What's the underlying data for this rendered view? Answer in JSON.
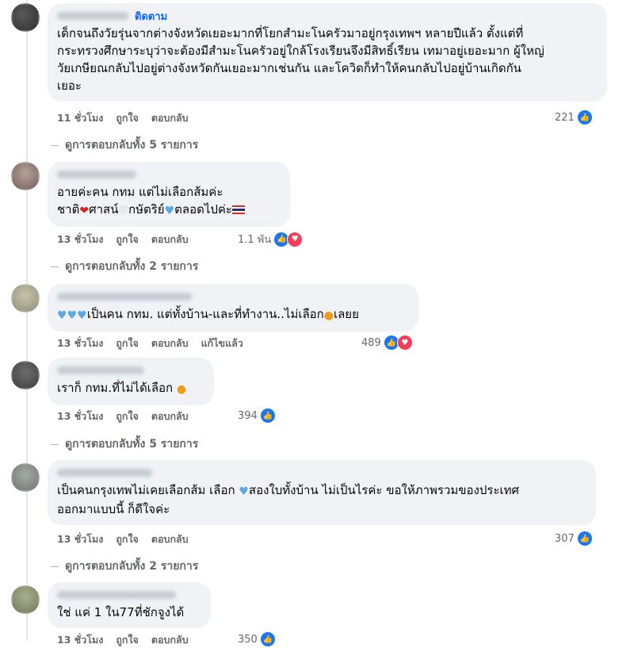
{
  "comments": [
    {
      "follow_label": "ติดตาม",
      "lines": [
        "เด็กจนถึงวัยรุ่นจากต่างจังหวัดเยอะมากที่โยกสำมะโนครัวมาอยู่กรุงเทพฯ หลายปีแล้ว ตั้งแต่ที่",
        "กระทรวงศึกษาระบุว่าจะต้องมีสำมะโนครัวอยู่ใกล้โรงเรียนจึงมีสิทธิ์เรียน เทมาอยู่เยอะมาก ผู้ใหญ่",
        "วัยเกษียณกลับไปอยู่ต่างจังหวัดกันเยอะมากเช่นกัน และโควิดก็ทำให้คนกลับไปอยู่บ้านเกิดกัน",
        "เยอะ"
      ],
      "time": "11 ชั่วโมง",
      "like": "ถูกใจ",
      "reply": "ตอบกลับ",
      "reaction_count": "221",
      "replies_label": "ดูการตอบกลับทั้ง 5 รายการ"
    },
    {
      "line1": "อายค่ะคน กทม แต่ไม่เลือกส้มค่ะ",
      "line2_parts": [
        "ชาติ",
        "ศาสน์",
        "กษัตริย์",
        "ตลอดไปค่ะ"
      ],
      "time": "13 ชั่วโมง",
      "like": "ถูกใจ",
      "reply": "ตอบกลับ",
      "reaction_count": "1.1 พัน",
      "replies_label": "ดูการตอบกลับทั้ง 2 รายการ"
    },
    {
      "text_a": "เป็นคน กทม. แต่ทั้งบ้าน-และที่ทำงาน..ไม่เลือก",
      "text_b": "เลยย",
      "time": "13 ชั่วโมง",
      "like": "ถูกใจ",
      "reply": "ตอบกลับ",
      "edited": "แก้ไขแล้ว",
      "reaction_count": "489"
    },
    {
      "text": "เราก็ กทม.ที่ไม่ได้เลือก",
      "time": "13 ชั่วโมง",
      "like": "ถูกใจ",
      "reply": "ตอบกลับ",
      "reaction_count": "394",
      "replies_label": "ดูการตอบกลับทั้ง 5 รายการ"
    },
    {
      "line1_a": "เป็นคนกรุงเทพไม่เคยเลือกส้ม เลือก",
      "line1_b": "สองใบทั้งบ้าน ไม่เป็นไรค่ะ ขอให้ภาพรวมของประเทศ",
      "line2": "ออกมาแบบนี้ ก็ดีใจค่ะ",
      "time": "13 ชั่วโมง",
      "like": "ถูกใจ",
      "reply": "ตอบกลับ",
      "reaction_count": "307",
      "replies_label": "ดูการตอบกลับทั้ง 2 รายการ"
    },
    {
      "text": "ใช่ แค่ 1 ใน77ที่ชักจูงได้",
      "time": "13 ชั่วโมง",
      "like": "ถูกใจ",
      "reply": "ตอบกลับ",
      "reaction_count": "350"
    }
  ],
  "icons": {
    "like": "thumbs-up-icon",
    "love": "heart-icon"
  },
  "colors": {
    "like": "#1877f2",
    "love": "#f33e58",
    "bubble": "#f0f2f5",
    "link": "#0866ff"
  }
}
